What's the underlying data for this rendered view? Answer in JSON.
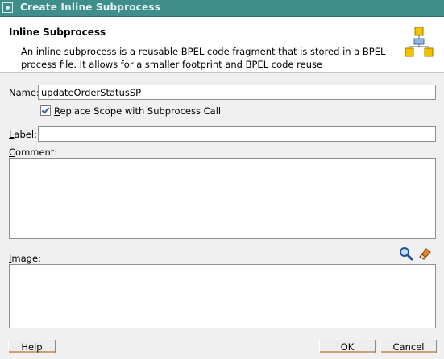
{
  "window": {
    "title": "Create Inline Subprocess"
  },
  "header": {
    "title": "Inline Subprocess",
    "description": "An inline subprocess is a reusable BPEL code fragment that is stored in a BPEL process file. It allows for a smaller footprint and BPEL code reuse",
    "icon": "subprocess-diagram-icon"
  },
  "form": {
    "name_label_u": "N",
    "name_label_rest": "ame:",
    "name_value": "updateOrderStatusSP",
    "replace_label_u": "R",
    "replace_label_rest": "eplace Scope with Subprocess Call",
    "replace_checked": true,
    "label_label_u": "L",
    "label_label_rest": "abel:",
    "label_value": "",
    "comment_label_u": "C",
    "comment_label_rest": "omment:",
    "comment_value": "",
    "image_label_u": "I",
    "image_label_rest": "mage:",
    "image_value": ""
  },
  "buttons": {
    "help": "Help",
    "ok": "OK",
    "cancel": "Cancel"
  },
  "colors": {
    "titlebar": "#3f8e8c",
    "accent": "#c9a27b"
  }
}
